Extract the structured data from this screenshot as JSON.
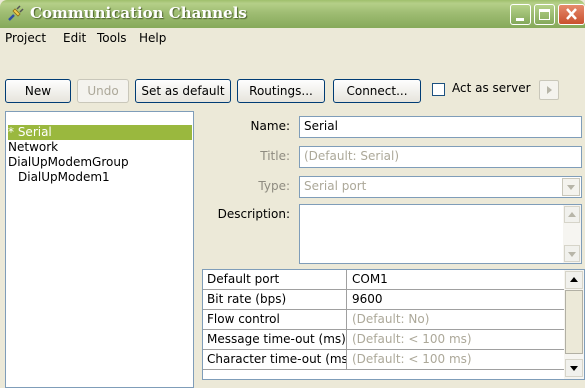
{
  "window": {
    "title": "Communication Channels"
  },
  "menu": {
    "project": "Project",
    "edit": "Edit",
    "tools": "Tools",
    "help": "Help"
  },
  "toolbar": {
    "new": "New",
    "undo": "Undo",
    "set_default": "Set as default",
    "routings": "Routings...",
    "connect": "Connect...",
    "act_as_server": "Act as server",
    "act_as_server_checked": false
  },
  "tree": {
    "items": [
      {
        "label": "* Serial",
        "selected": true
      },
      {
        "label": "Network",
        "selected": false
      },
      {
        "label": "DialUpModemGroup",
        "selected": false
      },
      {
        "label": "DialUpModem1",
        "selected": false
      }
    ]
  },
  "form": {
    "name_label": "Name:",
    "name_value": "Serial",
    "title_label": "Title:",
    "title_placeholder": "(Default: Serial)",
    "type_label": "Type:",
    "type_value": "Serial port",
    "description_label": "Description:"
  },
  "properties": {
    "rows": [
      {
        "name": "Default port",
        "value": "COM1",
        "is_default": false
      },
      {
        "name": "Bit rate (bps)",
        "value": "9600",
        "is_default": false
      },
      {
        "name": "Flow control",
        "value": "(Default: No)",
        "is_default": true
      },
      {
        "name": "Message time-out (ms)",
        "value": "(Default: < 100 ms)",
        "is_default": true
      },
      {
        "name": "Character time-out (ms)",
        "value": "(Default: < 100 ms)",
        "is_default": true
      }
    ]
  },
  "colors": {
    "titlebar": "#9fbd73",
    "selection": "#9ab83e",
    "close_button": "#c9502e"
  }
}
